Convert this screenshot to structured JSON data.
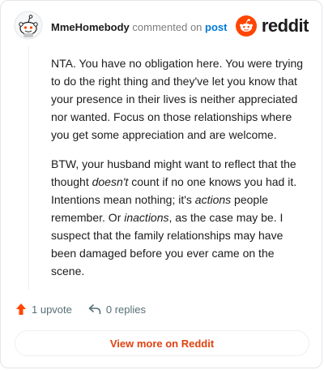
{
  "header": {
    "username": "MmeHomebody",
    "commented_text": "commented on",
    "post_link": "post"
  },
  "brand": {
    "name": "reddit",
    "color": "#ff4500"
  },
  "comment": {
    "p1": "NTA. You have no obligation here. You were trying to do the right thing and they've let you know that your presence in their lives is neither appreciated nor wanted. Focus on those relationships where you get some appreciation and are welcome.",
    "p2": {
      "t1": "BTW, your husband might want to reflect that the thought ",
      "e1": "doesn't",
      "t2": " count if no one knows you had it. Intentions mean nothing; it's ",
      "e2": "actions",
      "t3": " people remember. Or ",
      "e3": "inactions",
      "t4": ", as the case may be. I suspect that the family relationships may have been damaged before you ever came on the scene."
    }
  },
  "actions": {
    "upvote_label": "1 upvote",
    "replies_label": "0 replies",
    "upvote_icon": "upvote-arrow-icon",
    "reply_icon": "reply-icon"
  },
  "footer": {
    "view_more_label": "View more on Reddit",
    "accent": "#e2410f"
  }
}
